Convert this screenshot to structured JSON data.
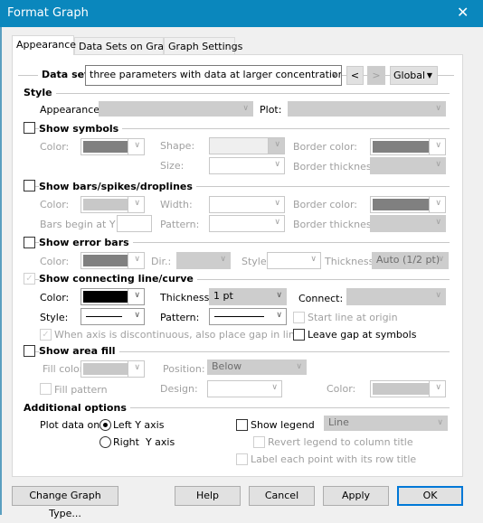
{
  "window": {
    "title": "Format Graph",
    "close_icon": "close-icon"
  },
  "tabs": [
    {
      "label": "Appearance",
      "active": true
    },
    {
      "label": "Data Sets on Graph"
    },
    {
      "label": "Graph Settings"
    }
  ],
  "dataset": {
    "label": "Data set:",
    "value": "three parameters with data at larger concentrations:Curve",
    "prev": "<",
    "next": ">",
    "scope": "Global"
  },
  "style": {
    "header": "Style",
    "appearance_label": "Appearance:",
    "plot_label": "Plot:"
  },
  "symbols": {
    "header": "Show symbols",
    "checked": false,
    "color_label": "Color:",
    "shape_label": "Shape:",
    "size_label": "Size:",
    "border_color_label": "Border color:",
    "border_thickness_label": "Border thickness:"
  },
  "bars": {
    "header": "Show bars/spikes/droplines",
    "checked": false,
    "color_label": "Color:",
    "width_label": "Width:",
    "border_color_label": "Border color:",
    "begin_label": "Bars begin at Y =",
    "pattern_label": "Pattern:",
    "border_thickness_label": "Border thickness:"
  },
  "errorbars": {
    "header": "Show error bars",
    "checked": false,
    "color_label": "Color:",
    "dir_label": "Dir.:",
    "style_label": "Style:",
    "thickness_label": "Thickness:",
    "thickness_value": "Auto (1/2 pt)"
  },
  "line": {
    "header": "Show connecting line/curve",
    "checked": true,
    "color_label": "Color:",
    "color": "#000000",
    "thickness_label": "Thickness:",
    "thickness_value": "1 pt",
    "connect_label": "Connect:",
    "style_label": "Style:",
    "pattern_label": "Pattern:",
    "start_origin": "Start line at origin",
    "gap_axis": "When axis is discontinuous, also place gap in line",
    "gap_symbols": "Leave gap at symbols"
  },
  "area": {
    "header": "Show area fill",
    "checked": false,
    "fill_color_label": "Fill color:",
    "position_label": "Position:",
    "position_value": "Below",
    "fill_pattern": "Fill pattern",
    "design_label": "Design:",
    "color_label": "Color:"
  },
  "additional": {
    "header": "Additional options",
    "plot_on_label": "Plot data on:",
    "left_axis": "Left Y axis",
    "right_axis": "Right  Y axis",
    "selected": "left",
    "show_legend": "Show legend",
    "legend_value": "Line",
    "revert_legend": "Revert legend to column title",
    "label_points": "Label each point with its row title"
  },
  "buttons": {
    "change_type": "Change Graph Type...",
    "help": "Help",
    "cancel": "Cancel",
    "apply": "Apply",
    "ok": "OK"
  }
}
